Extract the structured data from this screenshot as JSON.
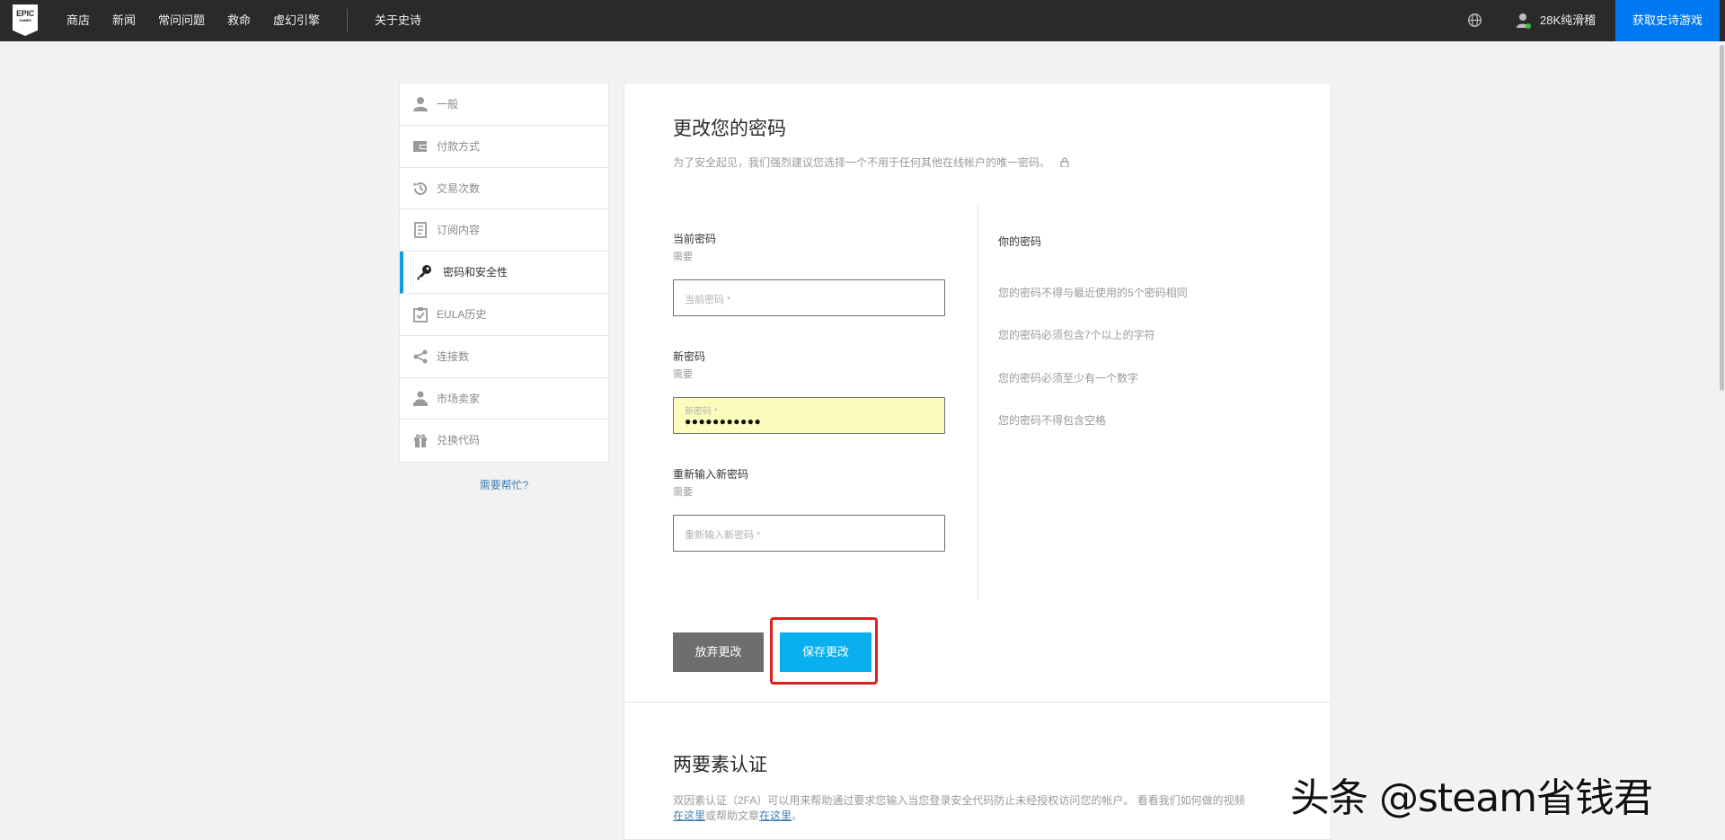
{
  "nav": {
    "logo_text": "EPIC",
    "logo_sub": "GAMES",
    "items": [
      "商店",
      "新闻",
      "常问问题",
      "救命",
      "虚幻引擎"
    ],
    "about": "关于史诗",
    "username": "28K纯滑稽",
    "get_button": "获取史诗游戏"
  },
  "sidebar": {
    "items": [
      {
        "label": "一般",
        "icon": "user-icon"
      },
      {
        "label": "付款方式",
        "icon": "wallet-icon"
      },
      {
        "label": "交易次数",
        "icon": "history-icon"
      },
      {
        "label": "订阅内容",
        "icon": "receipt-icon"
      },
      {
        "label": "密码和安全性",
        "icon": "key-icon",
        "active": true
      },
      {
        "label": "EULA历史",
        "icon": "clipboard-icon"
      },
      {
        "label": "连接数",
        "icon": "share-icon"
      },
      {
        "label": "市场卖家",
        "icon": "seller-icon"
      },
      {
        "label": "兑换代码",
        "icon": "gift-icon"
      }
    ],
    "help": "需要帮忙?"
  },
  "password": {
    "title": "更改您的密码",
    "subtitle": "为了安全起见，我们强烈建议您选择一个不用于任何其他在线帐户的唯一密码。",
    "current": {
      "label": "当前密码",
      "required": "需要",
      "placeholder": "当前密码 *"
    },
    "new": {
      "label": "新密码",
      "required": "需要",
      "placeholder": "新密码 *",
      "value": "●●●●●●●●●●●"
    },
    "confirm": {
      "label": "重新输入新密码",
      "required": "需要",
      "placeholder": "重新输入新密码 *"
    },
    "requirements_title": "你的密码",
    "requirements": [
      "您的密码不得与最近使用的5个密码相同",
      "您的密码必须包含7个以上的字符",
      "您的密码必须至少有一个数字",
      "您的密码不得包含空格"
    ],
    "discard": "放弃更改",
    "save": "保存更改"
  },
  "tfa": {
    "title": "两要素认证",
    "desc_part1": "双因素认证（2FA）可以用来帮助通过要求您输入当您登录安全代码防止未经授权访问您的帐户。 看看我们如何做的视频",
    "link1": "在这里",
    "desc_part2": "或帮助文章",
    "link2": "在这里",
    "desc_end": "。"
  },
  "watermark": "头条 @steam省钱君",
  "colors": {
    "accent": "#0aaff0",
    "nav_bg": "#2a2a2a",
    "get_button": "#0078f2",
    "highlight": "#e02020"
  }
}
